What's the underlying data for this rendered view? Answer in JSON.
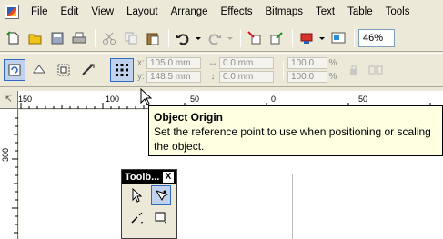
{
  "menu": {
    "items": [
      "File",
      "Edit",
      "View",
      "Layout",
      "Arrange",
      "Effects",
      "Bitmaps",
      "Text",
      "Table",
      "Tools"
    ]
  },
  "standard_toolbar": {
    "zoom_value": "46%",
    "icons": [
      "new-icon",
      "open-icon",
      "save-icon",
      "print-icon",
      "cut-icon",
      "copy-icon",
      "paste-icon",
      "undo-icon",
      "redo-icon",
      "import-icon",
      "export-icon",
      "application-launcher-icon",
      "welcome-screen-icon"
    ]
  },
  "property_bar": {
    "x_label": "x:",
    "x_value": "105.0 mm",
    "y_label": "y:",
    "y_value": "148.5 mm",
    "width_value": "0.0 mm",
    "height_value": "0.0 mm",
    "scale_x": "100.0",
    "scale_y": "100.0",
    "percent": "%"
  },
  "ruler": {
    "corner_label": "↸",
    "h_labels": [
      "150",
      "100",
      "50",
      "0",
      "50"
    ],
    "v_labels": [
      "300"
    ]
  },
  "tooltip": {
    "title": "Object Origin",
    "text": "Set the reference point to use when positioning or scaling the object."
  },
  "toolbox": {
    "title": "Toolb...",
    "close": "X"
  },
  "colors": {
    "background": "#ece9d8",
    "selected": "#c1d2ee",
    "selected_border": "#316ac5",
    "tooltip_bg": "#ffffe1"
  }
}
